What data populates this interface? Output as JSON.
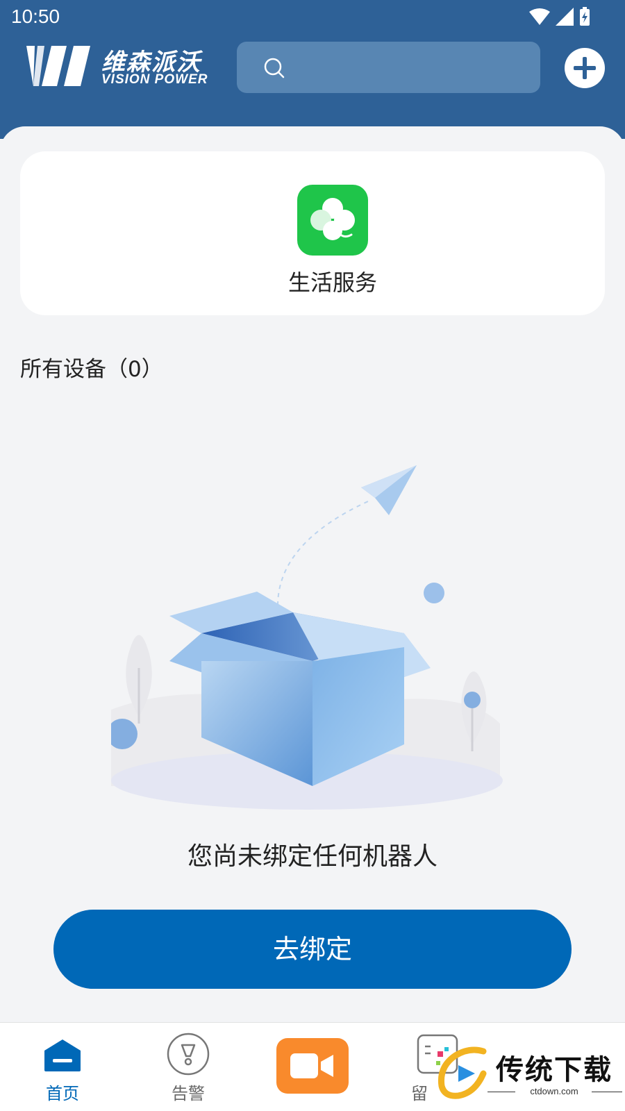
{
  "status_bar": {
    "time": "10:50"
  },
  "header": {
    "logo_cn": "维森派沃",
    "logo_en": "VISION POWER",
    "search_placeholder": ""
  },
  "service": {
    "label": "生活服务",
    "icon_color": "#1fc54a"
  },
  "devices": {
    "count_label": "所有设备（0）"
  },
  "empty_state": {
    "message": "您尚未绑定任何机器人",
    "bind_button_label": "去绑定"
  },
  "bottom_nav": {
    "items": [
      {
        "label": "首页",
        "icon": "home-icon",
        "active": true
      },
      {
        "label": "告警",
        "icon": "alarm-icon",
        "active": false
      },
      {
        "label": "",
        "icon": "video-icon",
        "active": false
      },
      {
        "label": "留",
        "icon": "message-icon",
        "active": false
      }
    ]
  },
  "watermark": {
    "title": "传统下载",
    "subtitle": "ctdown.com"
  },
  "colors": {
    "header": "#2e6197",
    "primary": "#0068b7",
    "video_button": "#f98a2c"
  }
}
